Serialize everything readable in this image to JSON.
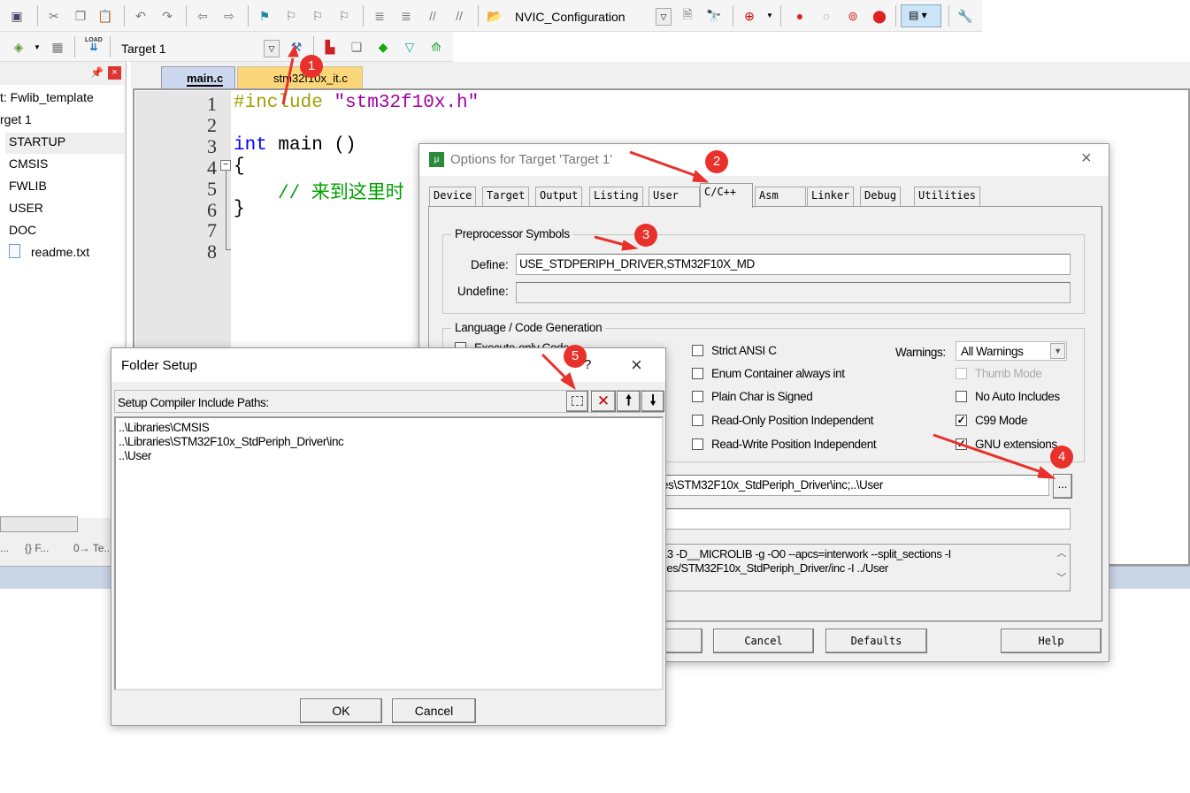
{
  "toolbar1": {
    "config_combo": "NVIC_Configuration",
    "icons": [
      "save-all-icon",
      "cut-icon",
      "copy-icon",
      "paste-icon",
      "undo-icon",
      "redo-icon",
      "nav-back-icon",
      "nav-forward-icon",
      "bookmark-icon",
      "prev-bookmark-icon",
      "next-bookmark-icon",
      "clear-bookmarks-icon",
      "indent-icon",
      "unindent-icon",
      "comment-icon",
      "uncomment-icon",
      "find-in-files-icon",
      "find-icon",
      "incremental-find-icon",
      "debug-icon",
      "breakpoint-icon",
      "disable-breakpoint-icon",
      "disable-all-breakpoints-icon",
      "kill-breakpoints-icon",
      "window-icon",
      "tools-icon"
    ]
  },
  "toolbar2": {
    "target_combo": "Target 1",
    "load_label": "LOAD",
    "icons": [
      "batch-build-icon",
      "download-icon",
      "options-for-target-icon",
      "manage-components-icon",
      "multi-project-icon",
      "pack-installer-icon",
      "select-pack-icon",
      "runtime-env-icon"
    ]
  },
  "project": {
    "items": [
      {
        "label": "t: Fwlib_template"
      },
      {
        "label": "rget 1"
      },
      {
        "label": "STARTUP"
      },
      {
        "label": "CMSIS"
      },
      {
        "label": "FWLIB"
      },
      {
        "label": "USER"
      },
      {
        "label": "DOC"
      },
      {
        "label": "readme.txt"
      }
    ],
    "bottom_tabs": [
      "...",
      "{} F...",
      "0→ Te..."
    ]
  },
  "editor": {
    "tabs": [
      {
        "label": "main.c",
        "active": true
      },
      {
        "label": "stm32f10x_it.c",
        "active": false
      }
    ],
    "line_numbers": [
      "1",
      "2",
      "3",
      "4",
      "5",
      "6",
      "7",
      "8"
    ],
    "lines": {
      "l1_kw": "#include",
      "l1_str": "\"stm32f10x.h\"",
      "l3_kw": "int",
      "l3_rest": "main ()",
      "l4": "{",
      "l5": "// 来到这里时",
      "l6": "}"
    }
  },
  "options": {
    "title": "Options for Target 'Target 1'",
    "tabs": [
      "Device",
      "Target",
      "Output",
      "Listing",
      "User",
      "C/C++",
      "Asm",
      "Linker",
      "Debug",
      "Utilities"
    ],
    "active_tab": "C/C++",
    "preprocessor": {
      "title": "Preprocessor Symbols",
      "define_label": "Define:",
      "define_value": "USE_STDPERIPH_DRIVER,STM32F10X_MD",
      "undefine_label": "Undefine:",
      "undefine_value": ""
    },
    "language": {
      "title": "Language / Code Generation",
      "hidden_first": "Execute-only Code",
      "col2": [
        {
          "label": "Strict ANSI C",
          "checked": false
        },
        {
          "label": "Enum Container always int",
          "checked": false
        },
        {
          "label": "Plain Char is Signed",
          "checked": false
        },
        {
          "label": "Read-Only Position Independent",
          "checked": false
        },
        {
          "label": "Read-Write Position Independent",
          "checked": false
        }
      ],
      "warnings_label": "Warnings:",
      "warnings_value": "All Warnings",
      "col3": [
        {
          "label": "Thumb Mode",
          "checked": false,
          "disabled": true
        },
        {
          "label": "No Auto Includes",
          "checked": false
        },
        {
          "label": "C99 Mode",
          "checked": true
        },
        {
          "label": "GNU extensions",
          "checked": true
        }
      ]
    },
    "include_paths_value": "es\\STM32F10x_StdPeriph_Driver\\inc;..\\User",
    "browse_label": "...",
    "misc_value": "",
    "compiler_control": [
      "13 -D__MICROLIB -g -O0 --apcs=interwork --split_sections -I",
      "ries/STM32F10x_StdPeriph_Driver/inc -I ../User"
    ],
    "buttons": {
      "cancel": "Cancel",
      "defaults": "Defaults",
      "help": "Help"
    }
  },
  "folder": {
    "title": "Folder Setup",
    "help": "?",
    "header": "Setup Compiler Include Paths:",
    "paths": [
      "..\\Libraries\\CMSIS",
      "..\\Libraries\\STM32F10x_StdPeriph_Driver\\inc",
      "..\\User"
    ],
    "ok": "OK",
    "cancel": "Cancel"
  },
  "annotations": [
    "1",
    "2",
    "3",
    "4",
    "5"
  ],
  "colors": {
    "arrow": "#e8312b",
    "keyword": "#0000ff",
    "preproc": "#a0a000",
    "string": "#a000a0",
    "comment": "#00a000"
  }
}
